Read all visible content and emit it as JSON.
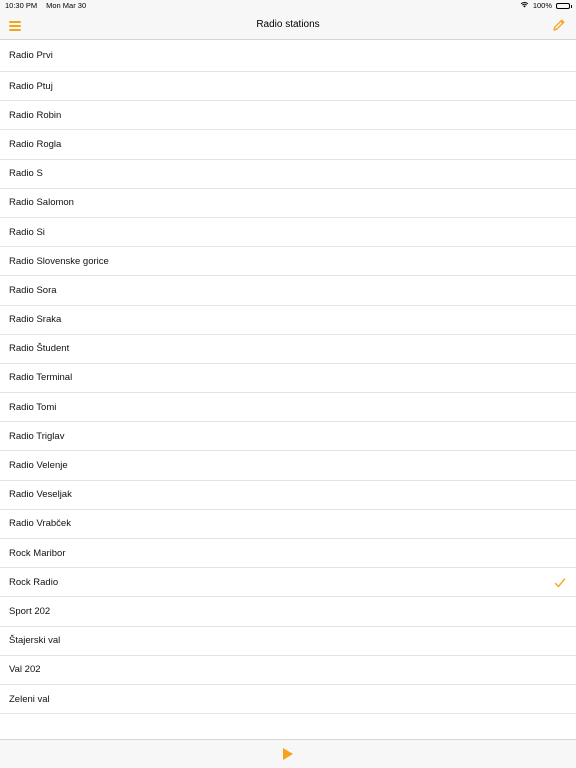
{
  "status_bar": {
    "time": "10:30 PM",
    "date": "Mon Mar 30",
    "battery": "100%"
  },
  "nav": {
    "title": "Radio stations"
  },
  "stations": [
    {
      "label": "Radio Prvi",
      "selected": false
    },
    {
      "label": "Radio Ptuj",
      "selected": false
    },
    {
      "label": "Radio Robin",
      "selected": false
    },
    {
      "label": "Radio Rogla",
      "selected": false
    },
    {
      "label": "Radio S",
      "selected": false
    },
    {
      "label": "Radio Salomon",
      "selected": false
    },
    {
      "label": "Radio Si",
      "selected": false
    },
    {
      "label": "Radio Slovenske gorice",
      "selected": false
    },
    {
      "label": "Radio Sora",
      "selected": false
    },
    {
      "label": "Radio Sraka",
      "selected": false
    },
    {
      "label": "Radio Študent",
      "selected": false
    },
    {
      "label": "Radio Terminal",
      "selected": false
    },
    {
      "label": "Radio Tomi",
      "selected": false
    },
    {
      "label": "Radio Triglav",
      "selected": false
    },
    {
      "label": "Radio Velenje",
      "selected": false
    },
    {
      "label": "Radio Veseljak",
      "selected": false
    },
    {
      "label": "Radio Vrabček",
      "selected": false
    },
    {
      "label": "Rock Maribor",
      "selected": false
    },
    {
      "label": "Rock Radio",
      "selected": true
    },
    {
      "label": "Sport 202",
      "selected": false
    },
    {
      "label": "Štajerski val",
      "selected": false
    },
    {
      "label": "Val 202",
      "selected": false
    },
    {
      "label": "Zeleni val",
      "selected": false
    }
  ],
  "colors": {
    "accent": "#f5a31a",
    "bar_background": "#f7f7f7",
    "separator": "#e3e3e3"
  },
  "icons": {
    "menu": "hamburger-menu-icon",
    "edit": "pencil-icon",
    "check": "checkmark-icon",
    "play": "play-icon",
    "wifi": "wifi-icon",
    "battery": "battery-icon"
  }
}
